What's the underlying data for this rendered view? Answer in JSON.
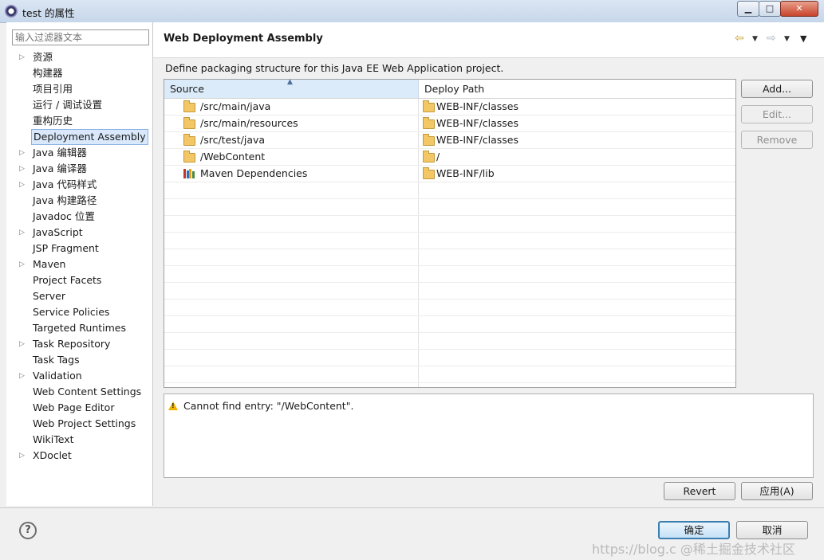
{
  "window": {
    "title": "test 的属性",
    "min": "▁",
    "max": "□",
    "close": "✕"
  },
  "filter": {
    "placeholder": "输入过滤器文本"
  },
  "sidebar": {
    "items": [
      {
        "label": "资源",
        "expandable": true
      },
      {
        "label": "构建器",
        "expandable": false
      },
      {
        "label": "项目引用",
        "expandable": false
      },
      {
        "label": "运行 / 调试设置",
        "expandable": false
      },
      {
        "label": "重构历史",
        "expandable": false
      },
      {
        "label": "Deployment Assembly",
        "expandable": false,
        "selected": true
      },
      {
        "label": "Java 编辑器",
        "expandable": true
      },
      {
        "label": "Java 编译器",
        "expandable": true
      },
      {
        "label": "Java 代码样式",
        "expandable": true
      },
      {
        "label": "Java 构建路径",
        "expandable": false
      },
      {
        "label": "Javadoc 位置",
        "expandable": false
      },
      {
        "label": "JavaScript",
        "expandable": true
      },
      {
        "label": "JSP Fragment",
        "expandable": false
      },
      {
        "label": "Maven",
        "expandable": true
      },
      {
        "label": "Project Facets",
        "expandable": false
      },
      {
        "label": "Server",
        "expandable": false
      },
      {
        "label": "Service Policies",
        "expandable": false
      },
      {
        "label": "Targeted Runtimes",
        "expandable": false
      },
      {
        "label": "Task Repository",
        "expandable": true
      },
      {
        "label": "Task Tags",
        "expandable": false
      },
      {
        "label": "Validation",
        "expandable": true
      },
      {
        "label": "Web Content Settings",
        "expandable": false
      },
      {
        "label": "Web Page Editor",
        "expandable": false
      },
      {
        "label": "Web Project Settings",
        "expandable": false
      },
      {
        "label": "WikiText",
        "expandable": false
      },
      {
        "label": "XDoclet",
        "expandable": true
      }
    ]
  },
  "page": {
    "title": "Web Deployment Assembly",
    "description": "Define packaging structure for this Java EE Web Application project."
  },
  "table": {
    "columns": [
      "Source",
      "Deploy Path"
    ],
    "rows": [
      {
        "source": "/src/main/java",
        "source_icon": "folder-icon",
        "deploy": "WEB-INF/classes"
      },
      {
        "source": "/src/main/resources",
        "source_icon": "folder-icon",
        "deploy": "WEB-INF/classes"
      },
      {
        "source": "/src/test/java",
        "source_icon": "folder-icon",
        "deploy": "WEB-INF/classes"
      },
      {
        "source": "/WebContent",
        "source_icon": "folder-icon",
        "deploy": "/"
      },
      {
        "source": "Maven Dependencies",
        "source_icon": "library-icon",
        "deploy": "WEB-INF/lib"
      }
    ]
  },
  "buttons": {
    "add": "Add...",
    "edit": "Edit...",
    "remove": "Remove",
    "revert": "Revert",
    "apply": "应用(A)",
    "ok": "确定",
    "cancel": "取消"
  },
  "message": {
    "text": "Cannot find entry: \"/WebContent\"."
  },
  "watermark": "https://blog.c @稀土掘金技术社区",
  "colors": {
    "selection": "#d9e8fb",
    "header_sorted": "#dcebfa",
    "folder": "#f3c766",
    "warning": "#f0b400"
  }
}
